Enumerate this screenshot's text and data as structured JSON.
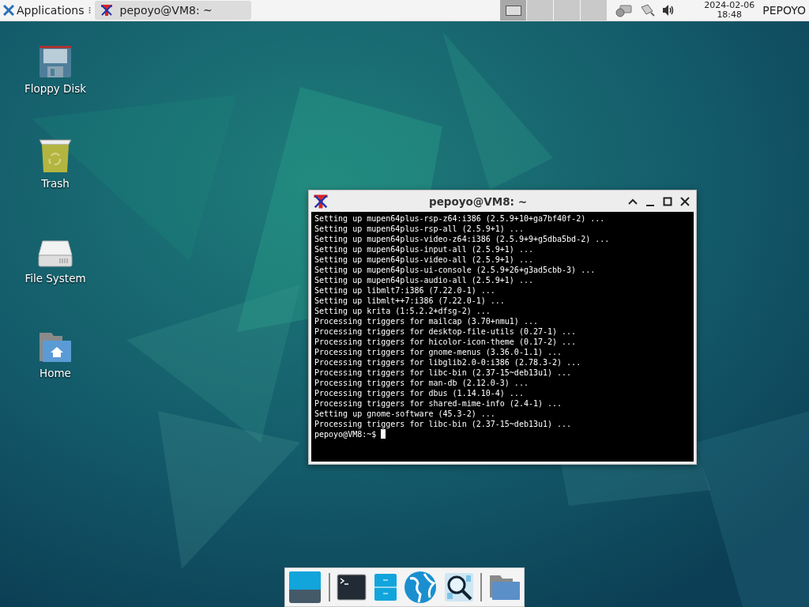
{
  "panel": {
    "app_menu": "Applications",
    "tasks": [
      {
        "title": "pepoyo@VM8: ~",
        "selected": true
      }
    ],
    "workspaces": [
      {
        "selected": true
      },
      {
        "selected": false
      },
      {
        "selected": false
      },
      {
        "selected": false
      }
    ],
    "clock": {
      "date": "2024-02-06",
      "time": "18:48"
    },
    "user": "PEPOYO"
  },
  "desktop_icons": [
    {
      "label": "Floppy Disk",
      "kind": "floppy"
    },
    {
      "label": "Trash",
      "kind": "trash"
    },
    {
      "label": "File System",
      "kind": "drive"
    },
    {
      "label": "Home",
      "kind": "home"
    }
  ],
  "terminal": {
    "title": "pepoyo@VM8: ~",
    "lines": [
      "Setting up mupen64plus-rsp-z64:i386 (2.5.9+10+ga7bf40f-2) ...",
      "Setting up mupen64plus-rsp-all (2.5.9+1) ...",
      "Setting up mupen64plus-video-z64:i386 (2.5.9+9+g5dba5bd-2) ...",
      "Setting up mupen64plus-input-all (2.5.9+1) ...",
      "Setting up mupen64plus-video-all (2.5.9+1) ...",
      "Setting up mupen64plus-ui-console (2.5.9+26+g3ad5cbb-3) ...",
      "Setting up mupen64plus-audio-all (2.5.9+1) ...",
      "Setting up libmlt7:i386 (7.22.0-1) ...",
      "Setting up libmlt++7:i386 (7.22.0-1) ...",
      "Setting up krita (1:5.2.2+dfsg-2) ...",
      "Processing triggers for mailcap (3.70+nmu1) ...",
      "Processing triggers for desktop-file-utils (0.27-1) ...",
      "Processing triggers for hicolor-icon-theme (0.17-2) ...",
      "Processing triggers for gnome-menus (3.36.0-1.1) ...",
      "Processing triggers for libglib2.0-0:i386 (2.78.3-2) ...",
      "Processing triggers for libc-bin (2.37-15~deb13u1) ...",
      "Processing triggers for man-db (2.12.0-3) ...",
      "Processing triggers for dbus (1.14.10-4) ...",
      "Processing triggers for shared-mime-info (2.4-1) ...",
      "Setting up gnome-software (45.3-2) ...",
      "Processing triggers for libc-bin (2.37-15~deb13u1) ..."
    ],
    "prompt": "pepoyo@VM8:~$"
  },
  "dock": [
    {
      "kind": "desktop"
    },
    {
      "kind": "separator"
    },
    {
      "kind": "terminal"
    },
    {
      "kind": "files"
    },
    {
      "kind": "browser"
    },
    {
      "kind": "search"
    },
    {
      "kind": "separator"
    },
    {
      "kind": "folder"
    }
  ]
}
